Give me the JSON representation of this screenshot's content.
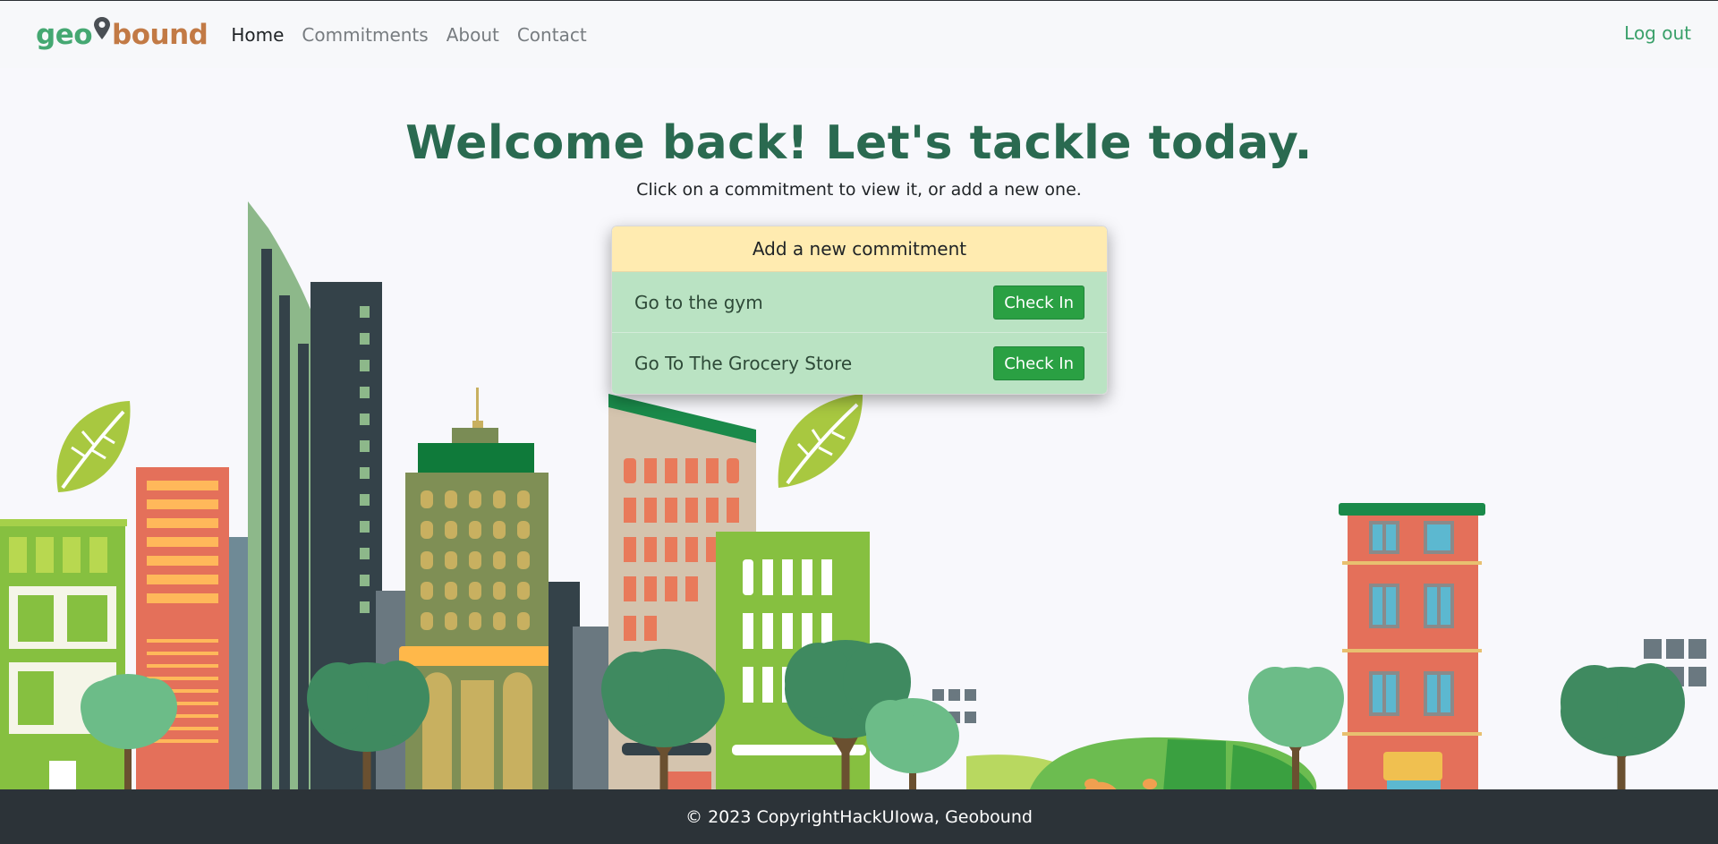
{
  "brand": {
    "part1": "geo",
    "part2": "bound"
  },
  "nav": {
    "items": [
      {
        "label": "Home",
        "active": true
      },
      {
        "label": "Commitments",
        "active": false
      },
      {
        "label": "About",
        "active": false
      },
      {
        "label": "Contact",
        "active": false
      }
    ],
    "logout_label": "Log out"
  },
  "hero": {
    "title": "Welcome back! Let's tackle today.",
    "subtitle": "Click on a commitment to view it, or add a new one."
  },
  "commitments": {
    "add_label": "Add a new commitment",
    "items": [
      {
        "label": "Go to the gym",
        "button": "Check In"
      },
      {
        "label": "Go To The Grocery Store",
        "button": "Check In"
      }
    ]
  },
  "footer": {
    "text": "© 2023 CopyrightHackUIowa, Geobound"
  },
  "colors": {
    "accent_green": "#2aa043",
    "title_green": "#2a6a50",
    "card_header": "#ffebb0",
    "card_row": "#bae3c3",
    "footer_bg": "#2c3338"
  }
}
